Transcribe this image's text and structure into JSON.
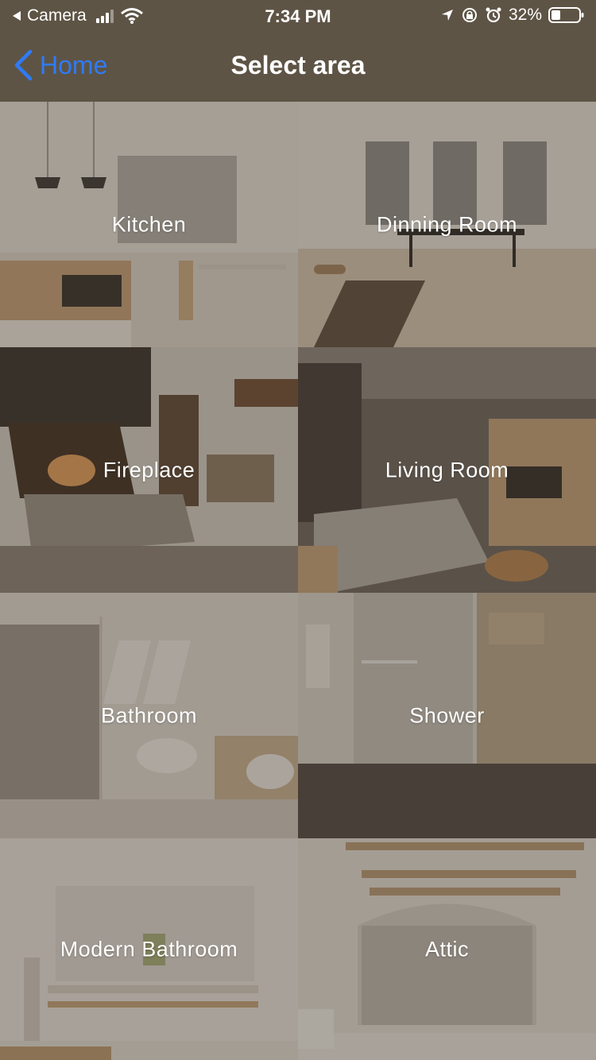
{
  "status_bar": {
    "back_app": "Camera",
    "time": "7:34 PM",
    "battery": "32%",
    "icons": [
      "back-triangle-icon",
      "signal-icon",
      "wifi-icon",
      "location-icon",
      "orientation-lock-icon",
      "alarm-icon",
      "battery-icon"
    ]
  },
  "nav": {
    "back_label": "Home",
    "title": "Select area"
  },
  "areas": [
    {
      "label": "Kitchen"
    },
    {
      "label": "Dinning Room"
    },
    {
      "label": "Fireplace"
    },
    {
      "label": "Living Room"
    },
    {
      "label": "Bathroom"
    },
    {
      "label": "Shower"
    },
    {
      "label": "Modern Bathroom"
    },
    {
      "label": "Attic"
    }
  ],
  "colors": {
    "nav_background": "#5e5445",
    "back_link": "#2f7bf6",
    "overlay": "#463a2c"
  }
}
